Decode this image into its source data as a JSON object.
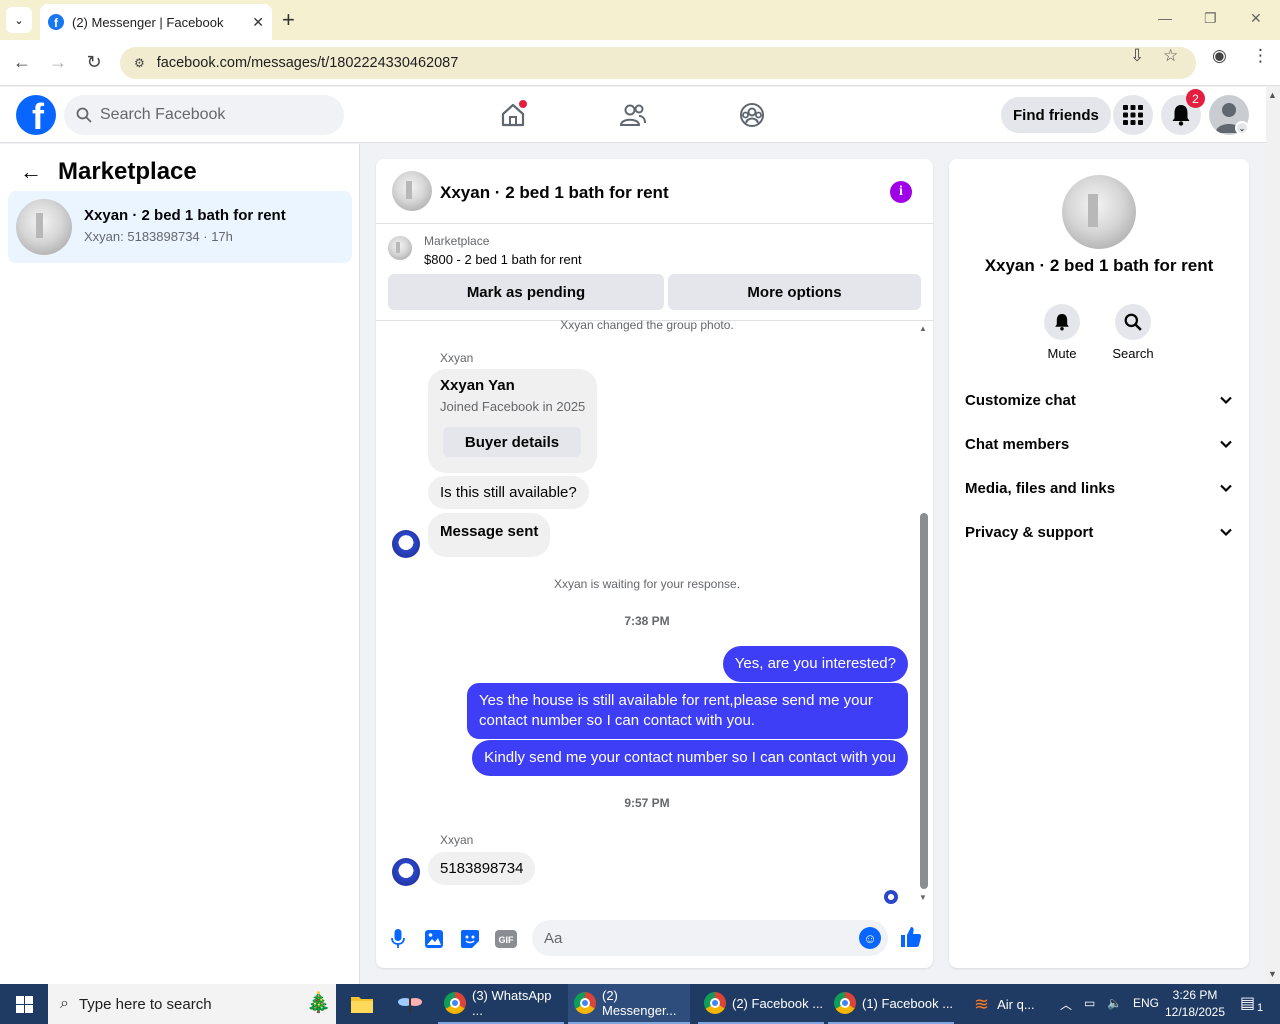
{
  "browser": {
    "tab_title": "(2) Messenger | Facebook",
    "url": "facebook.com/messages/t/1802224330462087"
  },
  "fb_header": {
    "search_placeholder": "Search Facebook",
    "find_friends": "Find friends",
    "notifications_count": "2"
  },
  "sidebar": {
    "title": "Marketplace",
    "conversation": {
      "title": "Xxyan · 2 bed 1 bath for rent",
      "subtitle": "Xxyan: 5183898734 · 17h"
    }
  },
  "chat": {
    "title": "Xxyan · 2 bed 1 bath for rent",
    "listing": {
      "label": "Marketplace",
      "price_title": "$800 - 2 bed 1 bath for rent",
      "mark_pending": "Mark as pending",
      "more_options": "More options"
    },
    "messages": {
      "sys_photo": "Xxyan changed the group photo.",
      "sender1": "Xxyan",
      "card_name": "Xxyan Yan",
      "card_joined": "Joined Facebook in 2025",
      "buyer_details": "Buyer details",
      "in1": "Is this still available?",
      "in2": "Message sent",
      "sys_waiting": "Xxyan is waiting for your response.",
      "time1": "7:38 PM",
      "out1": "Yes, are you interested?",
      "out2": "Yes the house is still available for rent,please send me your contact number so I can contact with you.",
      "out3": "Kindly send me your contact number so I can contact with you",
      "time2": "9:57 PM",
      "sender2": "Xxyan",
      "in3": "5183898734"
    },
    "composer_placeholder": "Aa"
  },
  "right_panel": {
    "title": "Xxyan · 2 bed 1 bath for rent",
    "mute": "Mute",
    "search": "Search",
    "sections": [
      "Customize chat",
      "Chat members",
      "Media, files and links",
      "Privacy & support"
    ]
  },
  "taskbar": {
    "search_placeholder": "Type here to search",
    "apps": [
      "(3) WhatsApp ...",
      "(2) Messenger...",
      "(2) Facebook ...",
      "(1) Facebook ..."
    ],
    "weather": "Air q...",
    "lang": "ENG",
    "time": "3:26 PM",
    "date": "12/18/2025",
    "notif_count": "1"
  },
  "colors": {
    "brand": "#0866ff",
    "outgoing_bubble": "#3e3ef7",
    "badge": "#e41e3f",
    "info_icon": "#a000e8"
  }
}
